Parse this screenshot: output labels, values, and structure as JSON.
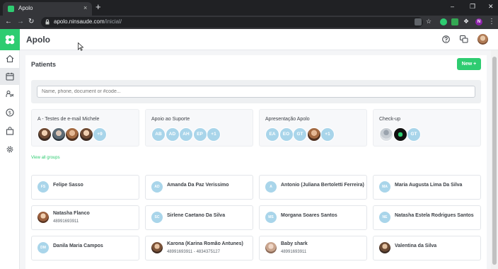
{
  "browser": {
    "tab_title": "Apolo",
    "tab_close": "×",
    "new_tab": "+",
    "url_host": "apolo.ninsaude.com",
    "url_path": "/inicial/",
    "profile_initial": "N",
    "window_controls": [
      "–",
      "❐",
      "✕"
    ]
  },
  "app": {
    "title": "Apolo"
  },
  "sidebar": {
    "items": [
      {
        "icon": "home-icon"
      },
      {
        "icon": "calendar-icon",
        "active": true
      },
      {
        "icon": "patients-icon"
      },
      {
        "icon": "finance-icon"
      },
      {
        "icon": "bag-icon"
      },
      {
        "icon": "gear-icon"
      }
    ]
  },
  "patients": {
    "title": "Patients",
    "new_label": "New +",
    "search_placeholder": "Name, phone, document or #code...",
    "view_all_groups": "View all groups"
  },
  "groups": [
    {
      "name": "A - Testes de e-mail Michele",
      "avatars": [
        {
          "t": "",
          "k": "photo"
        },
        {
          "t": "",
          "k": "photo3"
        },
        {
          "t": "",
          "k": "photo2"
        },
        {
          "t": "",
          "k": "photo"
        },
        {
          "t": "+9",
          "k": ""
        }
      ]
    },
    {
      "name": "Apoio ao Suporte",
      "avatars": [
        {
          "t": "AB",
          "k": ""
        },
        {
          "t": "AD",
          "k": ""
        },
        {
          "t": "AH",
          "k": ""
        },
        {
          "t": "EP",
          "k": ""
        },
        {
          "t": "+1",
          "k": ""
        }
      ]
    },
    {
      "name": "Apresentação Apolo",
      "avatars": [
        {
          "t": "EA",
          "k": ""
        },
        {
          "t": "EO",
          "k": ""
        },
        {
          "t": "GT",
          "k": ""
        },
        {
          "t": "",
          "k": "photo2"
        },
        {
          "t": "+1",
          "k": ""
        }
      ]
    },
    {
      "name": "Check-up",
      "avatars": [
        {
          "t": "",
          "k": "blank"
        },
        {
          "t": "",
          "k": "dark"
        },
        {
          "t": "GT",
          "k": ""
        }
      ]
    }
  ],
  "patient_cards": [
    {
      "initials": "FS",
      "name": "Felipe Sasso",
      "phone": "",
      "k": ""
    },
    {
      "initials": "AD",
      "name": "Amanda Da Paz Verissimo",
      "phone": "",
      "k": ""
    },
    {
      "initials": "A",
      "name": "Antonio (Juliana Bertoletti Ferreira)",
      "phone": "",
      "k": ""
    },
    {
      "initials": "MA",
      "name": "Maria Augusta Lima Da Silva",
      "phone": "",
      "k": ""
    },
    {
      "initials": "",
      "name": "Natasha Flanco",
      "phone": "48991693911",
      "k": "photo"
    },
    {
      "initials": "SC",
      "name": "Sirlene Caetano Da Silva",
      "phone": "",
      "k": ""
    },
    {
      "initials": "MS",
      "name": "Morgana Soares Santos",
      "phone": "",
      "k": ""
    },
    {
      "initials": "NE",
      "name": "Natasha Estela Rodrigues Santos",
      "phone": "",
      "k": ""
    },
    {
      "initials": "DM",
      "name": "Danila Maria Campos",
      "phone": "",
      "k": ""
    },
    {
      "initials": "",
      "name": "Karona (Karina Romão Antunes)",
      "phone": "48991693911 - 4834375127",
      "k": "photo2"
    },
    {
      "initials": "",
      "name": "Baby shark",
      "phone": "48991693911",
      "k": "photo3"
    },
    {
      "initials": "",
      "name": "Valentina da Silva",
      "phone": "",
      "k": "photo4"
    }
  ],
  "colors": {
    "brand": "#2ecc71",
    "avatar_placeholder": "#a9d5ea"
  }
}
